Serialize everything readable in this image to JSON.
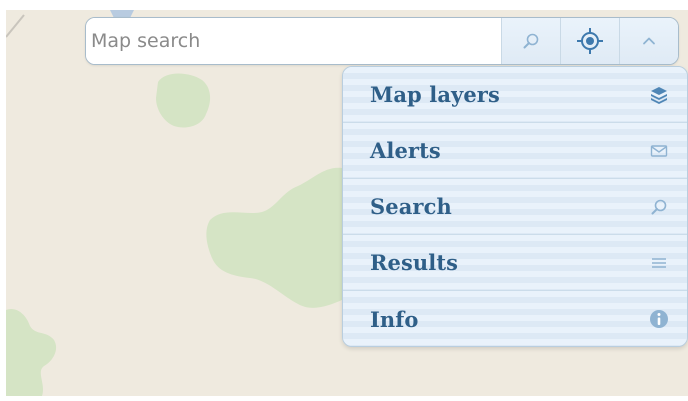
{
  "search": {
    "placeholder": "Map search"
  },
  "toolbar": {
    "search_icon": "search-icon",
    "locate_icon": "locate-icon",
    "collapse_icon": "chevron-up-icon"
  },
  "menu": {
    "items": [
      {
        "label": "Map layers",
        "icon": "layers-icon"
      },
      {
        "label": "Alerts",
        "icon": "envelope-icon"
      },
      {
        "label": "Search",
        "icon": "search-icon"
      },
      {
        "label": "Results",
        "icon": "list-icon"
      },
      {
        "label": "Info",
        "icon": "info-icon"
      }
    ]
  },
  "colors": {
    "map_background": "#efeadf",
    "park_green": "#d5e4c5",
    "accent_text": "#2f5f88",
    "icon_blue": "#8fb3d2"
  }
}
